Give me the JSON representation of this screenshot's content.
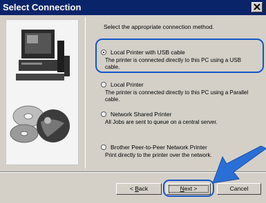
{
  "window": {
    "title": "Select Connection",
    "close_icon": "close-icon"
  },
  "main": {
    "prompt": "Select the appropriate connection method.",
    "options": [
      {
        "label": "Local Printer with USB cable",
        "description": "The printer is connected directly to this PC using a USB cable.",
        "checked": true
      },
      {
        "label": "Local Printer",
        "description": "The printer is connected directly to this PC using a Parallel cable.",
        "checked": false
      },
      {
        "label": "Network Shared Printer",
        "description": "All Jobs are sent to queue on a central server.",
        "checked": false
      },
      {
        "label": "Brother Peer-to-Peer Network Printer",
        "description": "Print directly to the printer over the network.",
        "checked": false
      }
    ]
  },
  "buttons": {
    "back": {
      "prefix": "< ",
      "mnemonic": "B",
      "rest": "ack"
    },
    "next": {
      "mnemonic": "N",
      "rest": "ext >"
    },
    "cancel": "Cancel"
  },
  "colors": {
    "titlebar": "#0a246a",
    "dialog": "#d4d0c8",
    "highlight": "#1555c7",
    "arrow": "#2a6fd6"
  }
}
